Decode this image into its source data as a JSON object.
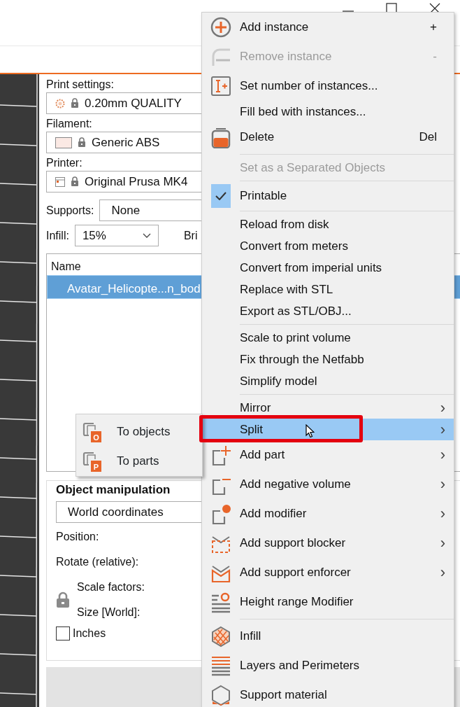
{
  "sidebar": {
    "print_settings": {
      "label": "Print settings:",
      "value": "0.20mm QUALITY"
    },
    "filament": {
      "label": "Filament:",
      "value": "Generic ABS"
    },
    "printer": {
      "label": "Printer:",
      "value": "Original Prusa MK4"
    },
    "supports": {
      "label": "Supports:",
      "value": "None"
    },
    "infill": {
      "label": "Infill:",
      "value": "15%"
    },
    "brim_label": "Bri",
    "object_list": {
      "columns": [
        "Name"
      ],
      "rows": [
        {
          "name": "Avatar_Helicopte...n_bod",
          "selected": true
        }
      ]
    },
    "object_manipulation": {
      "title": "Object manipulation",
      "coordinates": "World coordinates",
      "labels": [
        "Position:",
        "Rotate (relative):"
      ],
      "scale_label": "Scale factors:",
      "size_label": "Size [World]:",
      "inches": {
        "label": "Inches",
        "checked": false
      }
    }
  },
  "context_menu": {
    "items": [
      {
        "kind": "item",
        "label": "Add instance",
        "shortcut": "+",
        "disabled": false,
        "checked": false,
        "selected": false
      },
      {
        "kind": "item",
        "label": "Remove instance",
        "shortcut": "-",
        "disabled": true,
        "checked": false,
        "selected": false
      },
      {
        "kind": "item",
        "label": "Set number of instances...",
        "disabled": false,
        "checked": false,
        "selected": false
      },
      {
        "kind": "item",
        "label": "Fill bed with instances...",
        "disabled": false,
        "checked": false,
        "selected": false
      },
      {
        "kind": "item",
        "label": "Delete",
        "shortcut": "Del",
        "disabled": false,
        "checked": false,
        "selected": false
      },
      {
        "kind": "separator"
      },
      {
        "kind": "item",
        "label": "Set as a Separated Objects",
        "disabled": true,
        "checked": false,
        "selected": false
      },
      {
        "kind": "separator"
      },
      {
        "kind": "item",
        "label": "Printable",
        "disabled": false,
        "checked": true,
        "selected": false
      },
      {
        "kind": "separator"
      },
      {
        "kind": "item",
        "label": "Reload from disk",
        "disabled": false,
        "checked": false,
        "selected": false
      },
      {
        "kind": "item",
        "label": "Convert from meters",
        "disabled": false,
        "checked": false,
        "selected": false
      },
      {
        "kind": "item",
        "label": "Convert from imperial units",
        "disabled": false,
        "checked": false,
        "selected": false
      },
      {
        "kind": "item",
        "label": "Replace with STL",
        "disabled": false,
        "checked": false,
        "selected": false
      },
      {
        "kind": "item",
        "label": "Export as STL/OBJ...",
        "disabled": false,
        "checked": false,
        "selected": false
      },
      {
        "kind": "separator"
      },
      {
        "kind": "item",
        "label": "Scale to print volume",
        "disabled": false,
        "checked": false,
        "selected": false
      },
      {
        "kind": "item",
        "label": "Fix through the Netfabb",
        "disabled": false,
        "checked": false,
        "selected": false
      },
      {
        "kind": "item",
        "label": "Simplify model",
        "disabled": false,
        "checked": false,
        "selected": false
      },
      {
        "kind": "separator"
      },
      {
        "kind": "item",
        "label": "Mirror",
        "arrow": "›",
        "disabled": false,
        "checked": false,
        "selected": false
      },
      {
        "kind": "item",
        "label": "Split",
        "arrow": "›",
        "disabled": false,
        "checked": false,
        "selected": true
      },
      {
        "kind": "item",
        "label": "Add part",
        "arrow": "›",
        "disabled": false,
        "checked": false,
        "selected": false
      },
      {
        "kind": "item",
        "label": "Add negative volume",
        "arrow": "›",
        "disabled": false,
        "checked": false,
        "selected": false
      },
      {
        "kind": "item",
        "label": "Add modifier",
        "arrow": "›",
        "disabled": false,
        "checked": false,
        "selected": false
      },
      {
        "kind": "item",
        "label": "Add support blocker",
        "arrow": "›",
        "disabled": false,
        "checked": false,
        "selected": false
      },
      {
        "kind": "item",
        "label": "Add support enforcer",
        "arrow": "›",
        "disabled": false,
        "checked": false,
        "selected": false
      },
      {
        "kind": "item",
        "label": "Height range Modifier",
        "disabled": false,
        "checked": false,
        "selected": false
      },
      {
        "kind": "separator"
      },
      {
        "kind": "item",
        "label": "Infill",
        "disabled": false,
        "checked": false,
        "selected": false
      },
      {
        "kind": "item",
        "label": "Layers and Perimeters",
        "disabled": false,
        "checked": false,
        "selected": false
      },
      {
        "kind": "item",
        "label": "Support material",
        "disabled": false,
        "checked": false,
        "selected": false
      }
    ]
  },
  "split_submenu": {
    "items": [
      {
        "label": "To objects",
        "badge": "O",
        "selected": false
      },
      {
        "label": "To parts",
        "badge": "P",
        "selected": false
      }
    ]
  }
}
